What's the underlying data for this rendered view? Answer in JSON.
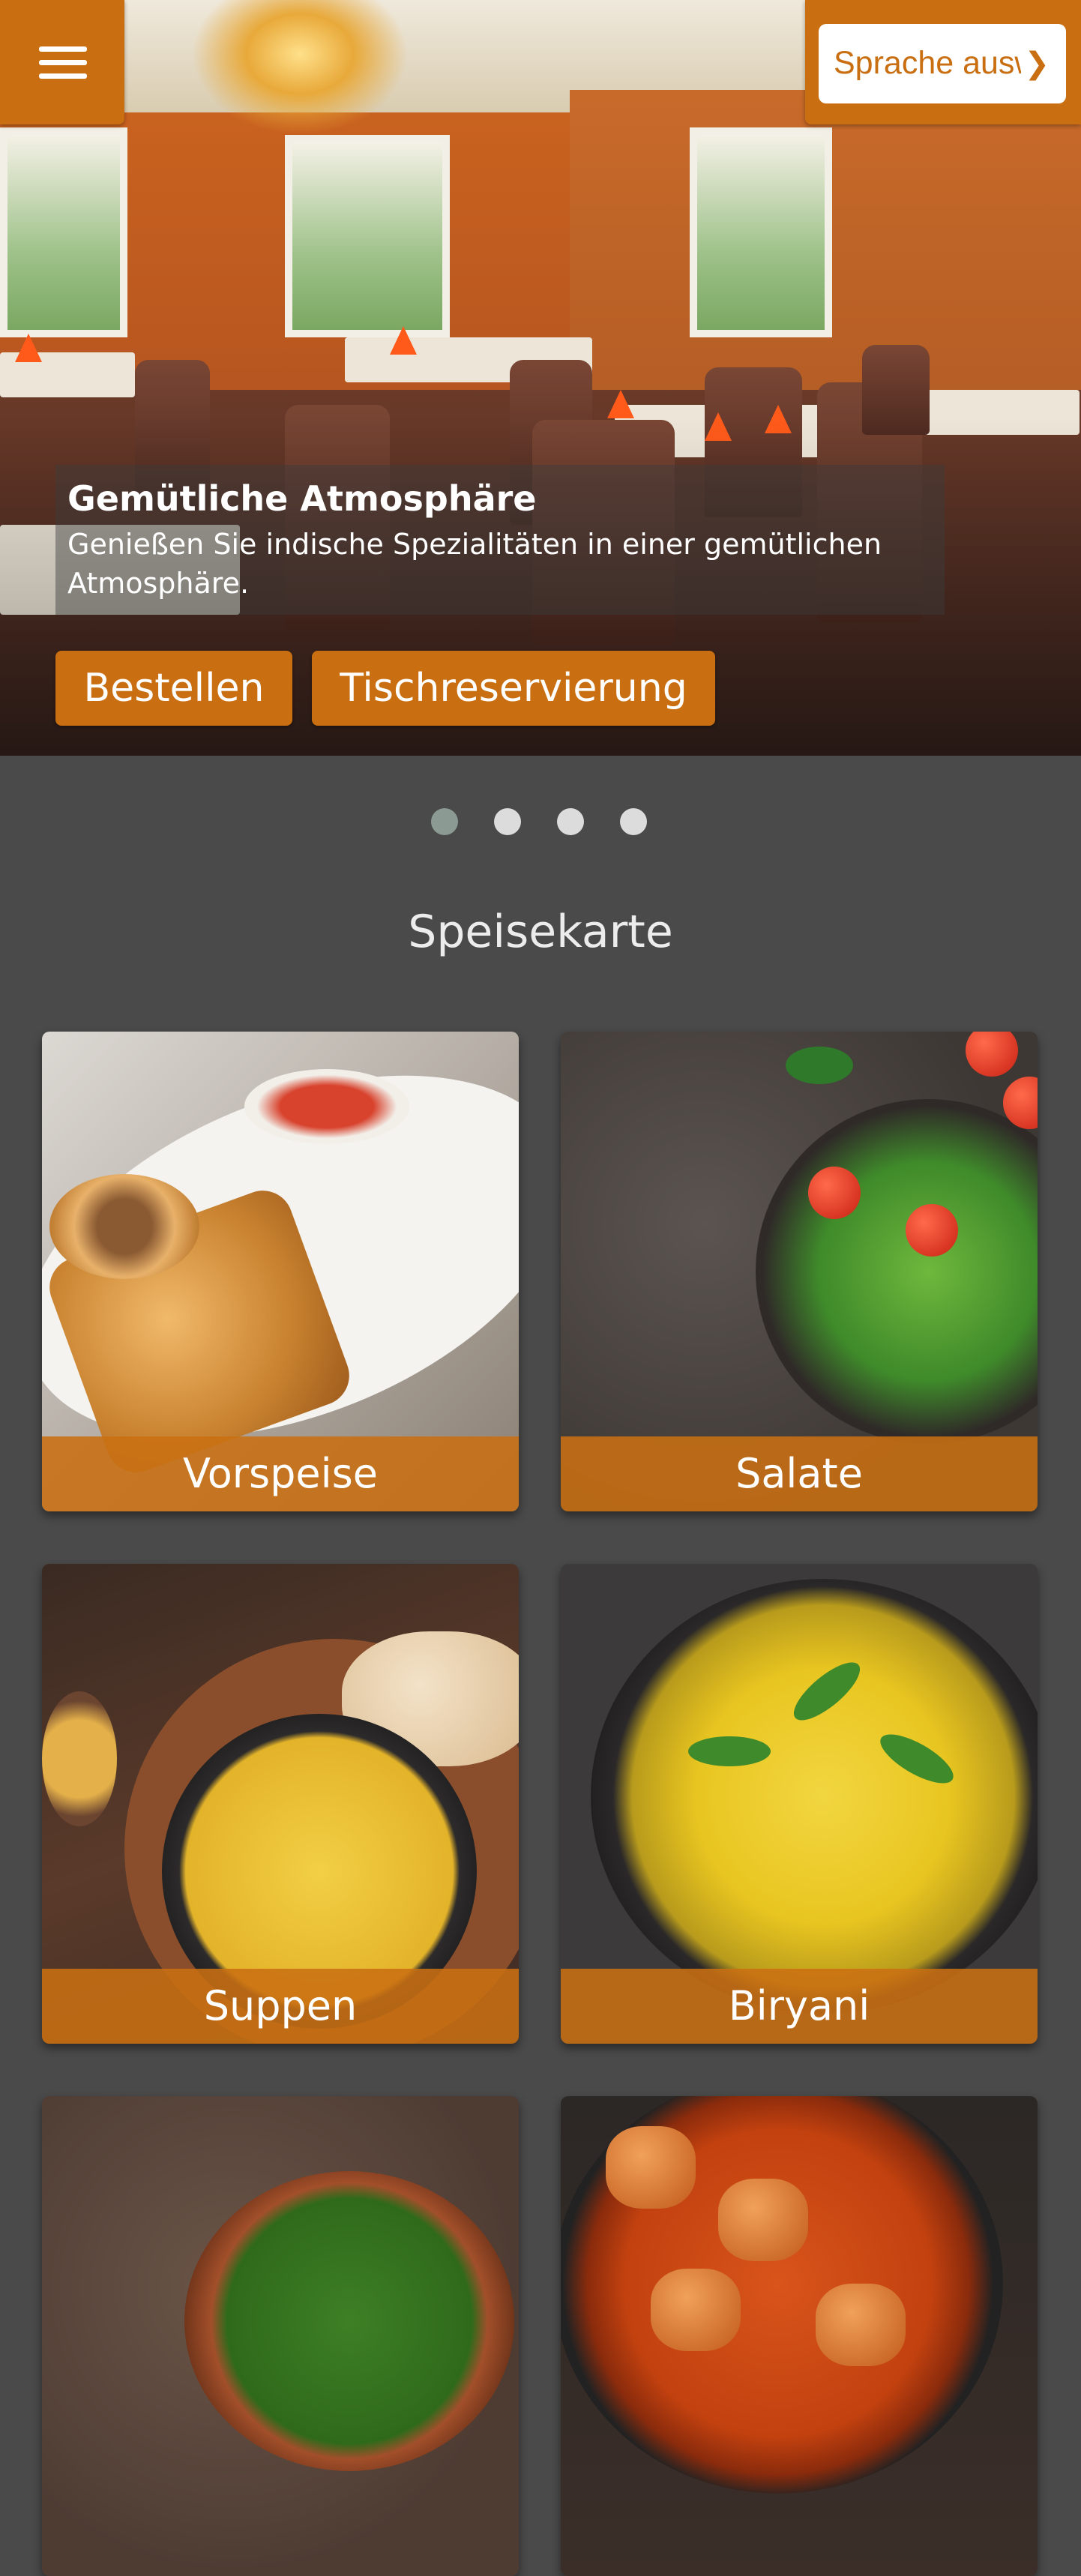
{
  "header": {
    "menu_icon": "hamburger-icon",
    "language_select": {
      "value": "Sprache auswählen",
      "options": [
        "Sprache auswählen"
      ]
    },
    "chevron_icon": "chevron-down-icon"
  },
  "hero": {
    "slide_title": "Gemütliche Atmosphäre",
    "slide_text": "Genießen Sie indische Spezialitäten in einer gemütlichen Atmosphäre.",
    "order_button": "Bestellen",
    "reservation_button": "Tischreservierung",
    "slides_total": 4,
    "active_slide": 1
  },
  "menu": {
    "title": "Speisekarte",
    "categories": [
      {
        "label": "Vorspeise"
      },
      {
        "label": "Salate"
      },
      {
        "label": "Suppen"
      },
      {
        "label": "Biryani"
      },
      {
        "label": ""
      },
      {
        "label": ""
      }
    ]
  },
  "colors": {
    "accent": "#c96f12",
    "background": "#4a4a4a",
    "dot_inactive": "#dcdcdc",
    "dot_active": "#8b9a92"
  }
}
